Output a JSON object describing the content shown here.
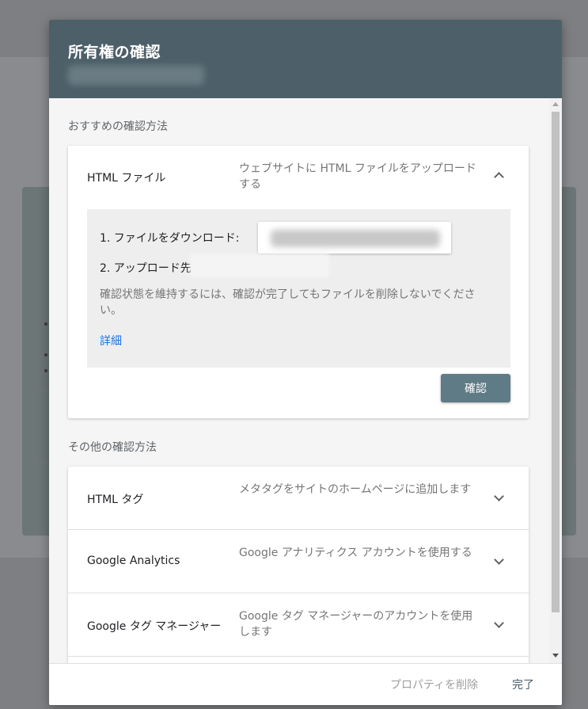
{
  "dialog": {
    "title": "所有権の確認"
  },
  "recommended": {
    "label": "おすすめの確認方法",
    "method": {
      "title": "HTML ファイル",
      "description": "ウェブサイトに HTML ファイルをアップロードする",
      "steps": {
        "download": "1. ファイルをダウンロード:",
        "upload": "2. アップロード先"
      },
      "hint": "確認状態を維持するには、確認が完了してもファイルを削除しないでください。",
      "details_link": "詳細",
      "verify_button": "確認"
    }
  },
  "other": {
    "label": "その他の確認方法",
    "methods": [
      {
        "title": "HTML タグ",
        "description": "メタタグをサイトのホームページに追加します"
      },
      {
        "title": "Google Analytics",
        "description": "Google アナリティクス アカウントを使用する"
      },
      {
        "title": "Google タグ マネージャー",
        "description": "Google タグ マネージャーのアカウントを使用します"
      }
    ]
  },
  "footer": {
    "remove_property": "プロパティを削除",
    "done": "完了"
  },
  "colors": {
    "header": "#4d6069",
    "button": "#5f7b86",
    "link": "#1a73e8"
  },
  "icons": [
    "chevron-up-icon",
    "chevron-down-icon"
  ]
}
